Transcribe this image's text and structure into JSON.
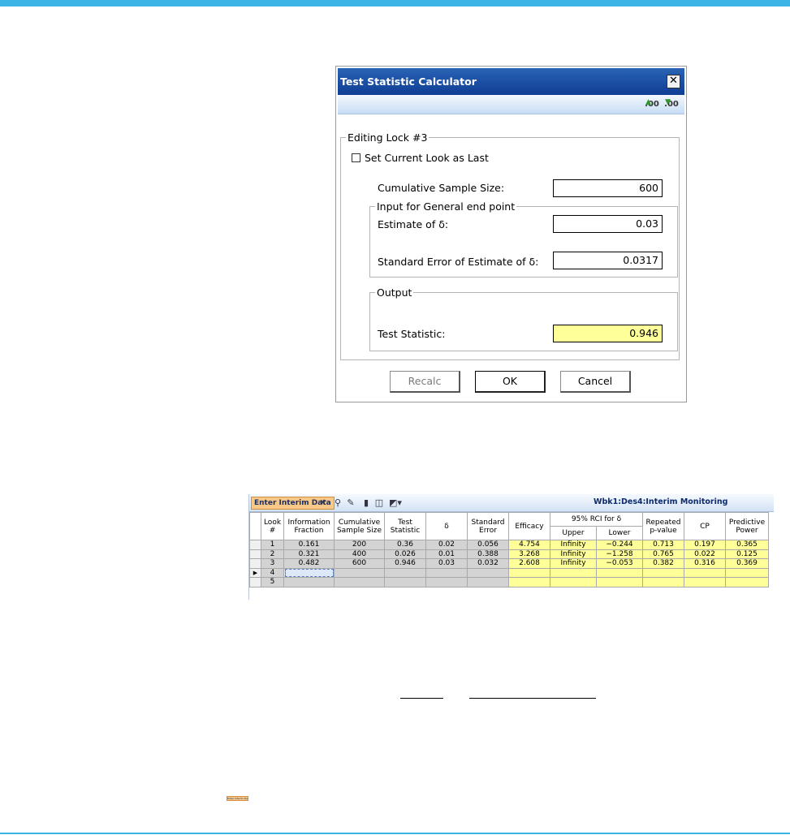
{
  "dialog": {
    "title": "Test Statistic Calculator",
    "close_label": "✕",
    "toolbar_icons": [
      "increase-decimals-icon",
      "decrease-decimals-icon"
    ],
    "toolbar_icon_text": [
      ".00",
      ".00"
    ],
    "group_main": "Editing Lock #3",
    "checkbox_label": "Set Current Look as Last",
    "checkbox_checked": false,
    "cumulative_sample_size_label": "Cumulative Sample Size:",
    "cumulative_sample_size_value": "600",
    "group_input": "Input for General end point",
    "estimate_label": "Estimate of δ:",
    "estimate_value": "0.03",
    "se_label": "Standard Error of Estimate of δ:",
    "se_value": "0.0317",
    "group_output": "Output",
    "test_stat_label": "Test Statistic:",
    "test_stat_value": "0.946",
    "buttons": {
      "recalc": "Recalc",
      "ok": "OK",
      "cancel": "Cancel"
    },
    "colors": {
      "title_bar": "#1e52a8",
      "output_highlight": "#ffff99"
    }
  },
  "grid_panel": {
    "tab_label": "Enter Interim Data",
    "title": "Wbk1:Des4:Interim Monitoring",
    "toolbar_icons": [
      "close-icon",
      "chart-icon",
      "edit-icon",
      "bar-chart-icon",
      "chart-tools-icon",
      "display-dropdown-icon"
    ],
    "headers": {
      "look": [
        "Look",
        "#"
      ],
      "info_fraction": [
        "Information",
        "Fraction"
      ],
      "cum_sample": [
        "Cumulative",
        "Sample Size"
      ],
      "test_stat": [
        "Test",
        "Statistic"
      ],
      "delta": "δ",
      "std_error": [
        "Standard",
        "Error"
      ],
      "efficacy": "Efficacy",
      "rci_group": "95% RCI for δ",
      "upper": "Upper",
      "lower": "Lower",
      "repeated_p": [
        "Repeated",
        "p-value"
      ],
      "cp": "CP",
      "pred_power": [
        "Predictive",
        "Power"
      ]
    },
    "rows": [
      {
        "look": "1",
        "info": "0.161",
        "n": "200",
        "ts": "0.36",
        "delta": "0.02",
        "se": "0.056",
        "eff": "4.754",
        "upper": "Infinity",
        "lower": "−0.244",
        "p": "0.713",
        "cp": "0.197",
        "pp": "0.365"
      },
      {
        "look": "2",
        "info": "0.321",
        "n": "400",
        "ts": "0.026",
        "delta": "0.01",
        "se": "0.388",
        "eff": "3.268",
        "upper": "Infinity",
        "lower": "−1.258",
        "p": "0.765",
        "cp": "0.022",
        "pp": "0.125"
      },
      {
        "look": "3",
        "info": "0.482",
        "n": "600",
        "ts": "0.946",
        "delta": "0.03",
        "se": "0.032",
        "eff": "2.608",
        "upper": "Infinity",
        "lower": "−0.053",
        "p": "0.382",
        "cp": "0.316",
        "pp": "0.369"
      },
      {
        "look": "4",
        "info": "",
        "n": "",
        "ts": "",
        "delta": "",
        "se": "",
        "eff": "",
        "upper": "",
        "lower": "",
        "p": "",
        "cp": "",
        "pp": ""
      },
      {
        "look": "5",
        "info": "",
        "n": "",
        "ts": "",
        "delta": "",
        "se": "",
        "eff": "",
        "upper": "",
        "lower": "",
        "p": "",
        "cp": "",
        "pp": ""
      }
    ],
    "current_row_marker": "▶",
    "colors": {
      "input_cells": "#d3d3d3",
      "output_cells": "#ffff99",
      "tab_chip": "#f7c887"
    }
  },
  "mini_chip": {
    "label": "Enter Interim Data"
  },
  "page_colors": {
    "accent": "#3cb4e6"
  }
}
